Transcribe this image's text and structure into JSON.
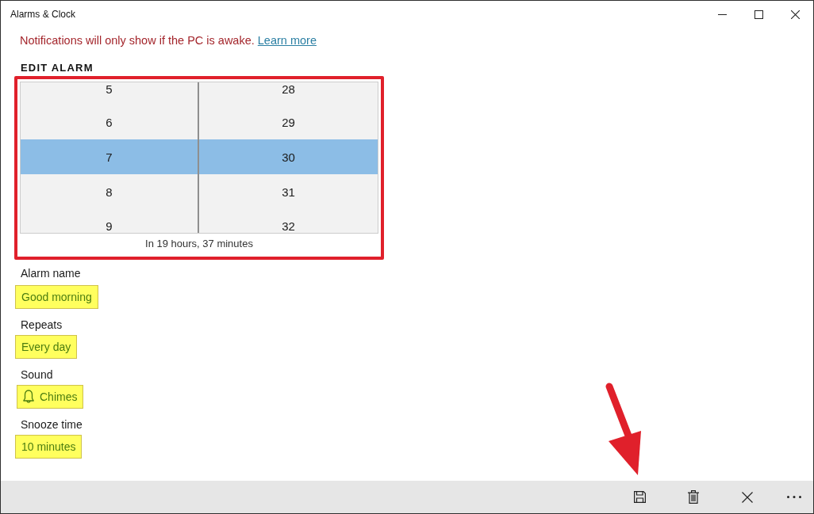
{
  "window": {
    "title": "Alarms & Clock",
    "controls": [
      {
        "kind": "minimize"
      },
      {
        "kind": "maximize"
      },
      {
        "kind": "close"
      }
    ]
  },
  "notice": {
    "text": "Notifications will only show if the PC is awake.",
    "link": "Learn more"
  },
  "section_title": "EDIT ALARM",
  "time_picker": {
    "highlighted": true,
    "columns": [
      {
        "items": [
          {
            "label": "5",
            "selected": false
          },
          {
            "label": "6",
            "selected": false
          },
          {
            "label": "7",
            "selected": true
          },
          {
            "label": "8",
            "selected": false
          },
          {
            "label": "9",
            "selected": false
          }
        ]
      },
      {
        "items": [
          {
            "label": "28",
            "selected": false
          },
          {
            "label": "29",
            "selected": false
          },
          {
            "label": "30",
            "selected": true
          },
          {
            "label": "31",
            "selected": false
          },
          {
            "label": "32",
            "selected": false
          }
        ]
      }
    ],
    "countdown": "In 19 hours, 37 minutes"
  },
  "fields": [
    {
      "kind": "name",
      "label": "Alarm name",
      "value": "Good morning",
      "highlighted": true
    },
    {
      "kind": "repeat",
      "label": "Repeats",
      "value": "Every day",
      "highlighted": true
    },
    {
      "kind": "sound",
      "label": "Sound",
      "value": "Chimes",
      "highlighted": true
    },
    {
      "kind": "snooze",
      "label": "Snooze time",
      "value": "10 minutes",
      "highlighted": true
    }
  ],
  "command_bar": {
    "commands": [
      {
        "kind": "save",
        "pointed": true
      },
      {
        "kind": "delete",
        "pointed": false
      },
      {
        "kind": "close",
        "pointed": false
      },
      {
        "kind": "more",
        "pointed": false
      }
    ]
  }
}
